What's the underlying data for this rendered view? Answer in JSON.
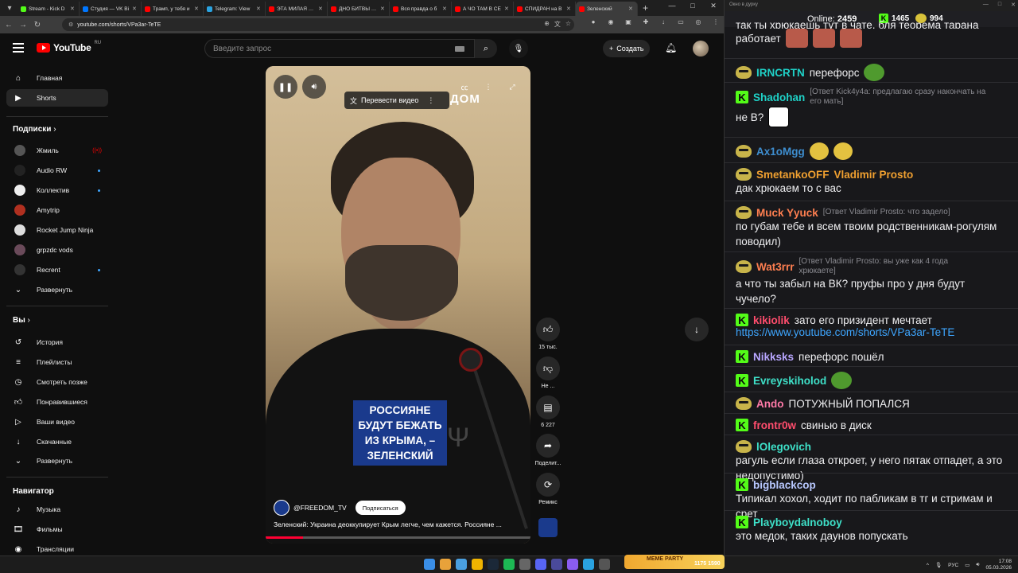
{
  "browser": {
    "tabs": [
      {
        "title": "Stream - Kick D",
        "color": "#53fc18",
        "active": false
      },
      {
        "title": "Студия — VK Bi",
        "color": "#0077ff",
        "active": false
      },
      {
        "title": "Трамп, у тебя и",
        "color": "#ff0000",
        "active": false
      },
      {
        "title": "Telegram: View",
        "color": "#2aa3e0",
        "active": false
      },
      {
        "title": "ЭТА МИЛАЯ ВЫ",
        "color": "#ff0000",
        "active": false
      },
      {
        "title": "ДНО БИТВЫ ЭК",
        "color": "#ff0000",
        "active": false
      },
      {
        "title": "Вся правда о б",
        "color": "#ff0000",
        "active": false
      },
      {
        "title": "А ЧО ТАМ В СЕ",
        "color": "#ff0000",
        "active": false
      },
      {
        "title": "СПИДРАН на В",
        "color": "#ff0000",
        "active": false
      },
      {
        "title": "Зеленский",
        "color": "#ff0000",
        "active": true
      }
    ],
    "url": "youtube.com/shorts/VPa3ar-TeTE"
  },
  "youtube": {
    "logo_text": "YouTube",
    "country": "RU",
    "search_placeholder": "Введите запрос",
    "create_label": "Создать",
    "sidebar": {
      "main": [
        {
          "label": "Главная",
          "icon": "home-icon",
          "active": false
        },
        {
          "label": "Shorts",
          "icon": "shorts-icon",
          "active": true
        }
      ],
      "subs_heading": "Подписки",
      "subs": [
        {
          "label": "Жмиль",
          "indicator": "live",
          "color": "#555"
        },
        {
          "label": "Audio RW",
          "indicator": "dot",
          "color": "#222"
        },
        {
          "label": "Коллектив",
          "indicator": "dot",
          "color": "#eee"
        },
        {
          "label": "Amytrip",
          "indicator": "",
          "color": "#b03020"
        },
        {
          "label": "Rocket Jump Ninja",
          "indicator": "",
          "color": "#ddd"
        },
        {
          "label": "grpzdc vods",
          "indicator": "",
          "color": "#6a4a5a"
        },
        {
          "label": "Recrent",
          "indicator": "dot",
          "color": "#333"
        }
      ],
      "subs_expand": "Развернуть",
      "you_heading": "Вы",
      "you": [
        {
          "label": "История",
          "icon": "history-icon"
        },
        {
          "label": "Плейлисты",
          "icon": "playlist-icon"
        },
        {
          "label": "Смотреть позже",
          "icon": "clock-icon"
        },
        {
          "label": "Понравившиеся",
          "icon": "like-icon"
        },
        {
          "label": "Ваши видео",
          "icon": "video-icon"
        },
        {
          "label": "Скачанные",
          "icon": "download-icon"
        }
      ],
      "you_expand": "Развернуть",
      "nav_heading": "Навигатор",
      "nav": [
        {
          "label": "Музыка",
          "icon": "music-icon"
        },
        {
          "label": "Фильмы",
          "icon": "film-icon"
        },
        {
          "label": "Трансляции",
          "icon": "live-icon"
        }
      ]
    },
    "short": {
      "translate_label": "Перевести видео",
      "logo_text": "ДОМ",
      "caption": "РОССИЯНЕ БУДУТ БЕЖАТЬ ИЗ КРЫМА, – ЗЕЛЕНСКИЙ",
      "channel": "@FREEDOM_TV",
      "subscribe_label": "Подписаться",
      "title": "Зеленский: Украина деоккупирует Крым легче, чем кажется. Россияне ...",
      "progress": 0.14
    },
    "actions": {
      "likes": "15 тыс.",
      "dislike": "Не ...",
      "comments": "6 227",
      "share": "Поделит...",
      "remix": "Ремикс"
    }
  },
  "chat": {
    "window_title": "Окно в дурку",
    "online_label": "Online:",
    "online_count": "2459",
    "kick_count": "1465",
    "vk_count": "994",
    "top_partial": "так ты хрюкаешь тут в чате, бля теорема тарана",
    "top_partial2": "работает",
    "messages": [
      {
        "badge": "vk",
        "nick": "IRNCRTN",
        "color": "#1fd2c8",
        "text": "перефорс",
        "reply": ""
      },
      {
        "badge": "kick",
        "nick": "Shadohan",
        "color": "#1fd2c8",
        "reply": "[Ответ Kick4y4a: предлагаю сразу накончать на его мать]",
        "text": "не В?"
      },
      {
        "badge": "vk",
        "nick": "Ax1oMgg",
        "color": "#3e8ed0",
        "text": "",
        "reply": ""
      },
      {
        "badge": "vk",
        "nick": "SmetankoOFF",
        "color": "#f0a030",
        "nick2": "Vladimir Prosto",
        "text": "дак хрюкаем то с вас",
        "reply": ""
      },
      {
        "badge": "vk",
        "nick": "Muck Yyuck",
        "color": "#ff7f50",
        "reply": "[Ответ Vladimir Prosto: что задело]",
        "text": "по губам тебе и всем твоим родственникам-рогулям поводил)"
      },
      {
        "badge": "vk",
        "nick": "Wat3rrr",
        "color": "#ff7f50",
        "reply": "[Ответ Vladimir Prosto: вы уже как 4 года  хрюкаете]",
        "text": "а что ты забыл на ВК? пруфы про у дня будут чучело?"
      },
      {
        "badge": "kick",
        "nick": "kikiolik",
        "color": "#ff4d6d",
        "text": "зато его призидент мечтает",
        "link": "https://www.youtube.com/shorts/VPa3ar-TeTE"
      },
      {
        "badge": "kick",
        "nick": "Nikksks",
        "color": "#b8a6ff",
        "text": "перефорс пошёл"
      },
      {
        "badge": "kick",
        "nick": "Evreyskiholod",
        "color": "#3ee0c8",
        "text": ""
      },
      {
        "badge": "vk",
        "nick": "Ando",
        "color": "#ff7aa8",
        "text": "ПОТУЖНЫЙ ПОПАЛСЯ"
      },
      {
        "badge": "kick",
        "nick": "frontr0w",
        "color": "#ff4d6d",
        "text": "свинью в диск"
      },
      {
        "badge": "vk",
        "nick": "lOlegovich",
        "color": "#3ee0c8",
        "text": "рагуль если глаза откроет, у него пятак отпадет, а это недопустимо)"
      },
      {
        "badge": "kick",
        "nick": "bigblackcop",
        "color": "#b8c8ff",
        "text": "Типикал хохол, ходит по пабликам в тг и стримам и срет"
      },
      {
        "badge": "kick",
        "nick": "Playboydalnoboy",
        "color": "#3ee0c8",
        "text": "это медок, таких даунов попускать"
      }
    ]
  },
  "taskbar": {
    "game_label": "MEME PARTY",
    "game_stats": "1175 1590",
    "lang": "РУС",
    "time": "17:08",
    "date": "05.03.2026"
  }
}
